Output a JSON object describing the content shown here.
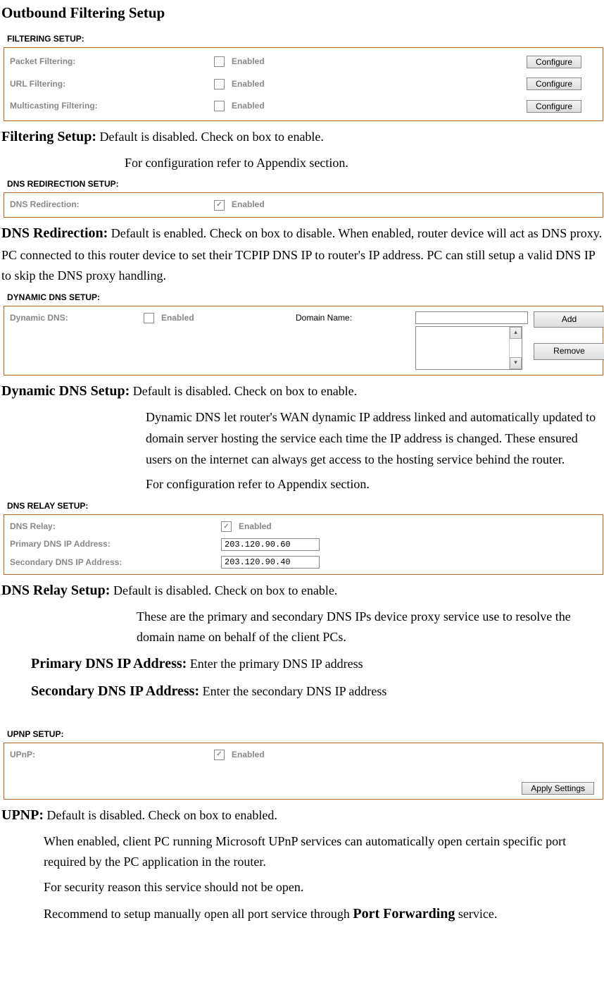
{
  "page_title": "Outbound Filtering Setup",
  "filtering_setup": {
    "panel_title": "FILTERING SETUP:",
    "rows": [
      {
        "label": "Packet Filtering:",
        "checked": false,
        "option": "Enabled",
        "button": "Configure"
      },
      {
        "label": "URL Filtering:",
        "checked": false,
        "option": "Enabled",
        "button": "Configure"
      },
      {
        "label": "Multicasting Filtering:",
        "checked": false,
        "option": "Enabled",
        "button": "Configure"
      }
    ],
    "desc_heading": "Filtering Setup:",
    "desc1": " Default is disabled. Check on box to enable.",
    "desc2": "For configuration refer to Appendix section."
  },
  "dns_redirection": {
    "panel_title": "DNS REDIRECTION SETUP:",
    "row": {
      "label": "DNS Redirection:",
      "checked": true,
      "option": "Enabled"
    },
    "desc_heading": "DNS Redirection:",
    "desc": " Default is enabled. Check on box to disable. When enabled, router device will act as DNS proxy. PC connected to this router device to set their TCPIP DNS IP to router's IP address.   PC can still setup a valid DNS IP to skip the DNS proxy handling."
  },
  "dynamic_dns": {
    "panel_title": "DYNAMIC DNS SETUP:",
    "row": {
      "label": "Dynamic DNS:",
      "checked": false,
      "option": "Enabled",
      "domain_label": "Domain Name:",
      "domain_value": "",
      "add": "Add",
      "remove": "Remove"
    },
    "desc_heading": "Dynamic DNS Setup:",
    "desc1": " Default is disabled. Check on box to enable.",
    "desc2": "Dynamic DNS let router's WAN dynamic IP address linked and automatically updated to domain server hosting the service each time the IP address is changed. These ensured users on the internet can always get access to the hosting service behind the router.",
    "desc3": "For configuration refer to Appendix section."
  },
  "dns_relay": {
    "panel_title": "DNS RELAY SETUP:",
    "rows": [
      {
        "label": "DNS Relay:",
        "type": "check",
        "checked": true,
        "option": "Enabled"
      },
      {
        "label": "Primary DNS IP Address:",
        "type": "text",
        "value": "203.120.90.60"
      },
      {
        "label": "Secondary DNS IP Address:",
        "type": "text",
        "value": "203.120.90.40"
      }
    ],
    "desc_heading": "DNS Relay Setup:",
    "desc1": " Default is disabled. Check on box to enable.",
    "desc2": "These are the primary and secondary DNS IPs device proxy service use to resolve the domain name on behalf of the client PCs.",
    "primary_heading": "Primary DNS IP Address:",
    "primary_desc": " Enter the primary DNS IP address",
    "secondary_heading": "Secondary DNS IP Address:",
    "secondary_desc": " Enter the secondary DNS IP address"
  },
  "upnp": {
    "panel_title": "UPNP SETUP:",
    "row": {
      "label": "UPnP:",
      "checked": true,
      "option": "Enabled"
    },
    "apply": "Apply Settings",
    "desc_heading": "UPNP:",
    "desc1": " Default is disabled. Check on box to enabled.",
    "desc2": "When enabled, client PC running Microsoft UPnP services can automatically open certain specific port required by the PC application in the router.",
    "desc3": "For security reason this service should not be open.",
    "desc4_prefix": "Recommend to setup manually open all port service through ",
    "desc4_bold": "Port Forwarding",
    "desc4_suffix": " service."
  }
}
